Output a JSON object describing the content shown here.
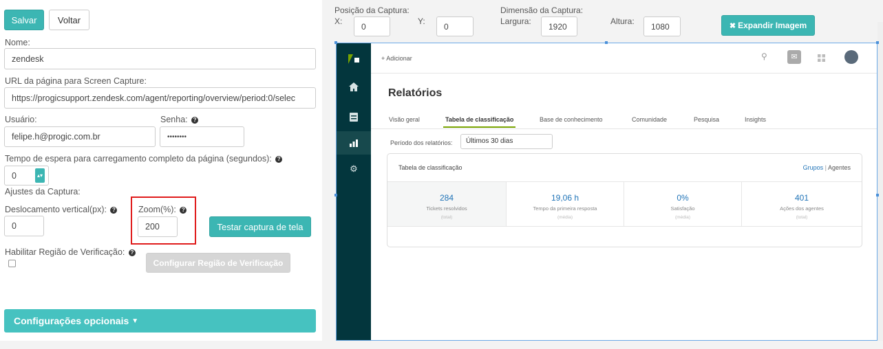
{
  "form": {
    "save_label": "Salvar",
    "back_label": "Voltar",
    "name_label": "Nome:",
    "name_value": "zendesk",
    "url_label": "URL da página para Screen Capture:",
    "url_value": "https://progicsupport.zendesk.com/agent/reporting/overview/period:0/selec",
    "user_label": "Usuário:",
    "user_value": "felipe.h@progic.com.br",
    "password_label": "Senha:",
    "password_value": "••••••••",
    "wait_label": "Tempo de espera para carregamento completo da página (segundos):",
    "wait_value": "0",
    "capture_settings_label": "Ajustes da Captura:",
    "vertical_offset_label": "Deslocamento vertical(px):",
    "vertical_offset_value": "0",
    "zoom_label": "Zoom(%):",
    "zoom_value": "200",
    "test_capture_label": "Testar captura de tela",
    "enable_region_label": "Habilitar Região de Verificação:",
    "configure_region_label": "Configurar Região de Verificação",
    "optional_settings_label": "Configurações opcionais",
    "help_glyph": "?"
  },
  "capture": {
    "position_label": "Posição da Captura:",
    "x_label": "X:",
    "x_value": "0",
    "y_label": "Y:",
    "y_value": "0",
    "dimension_label": "Dimensão da Captura:",
    "width_label": "Largura:",
    "width_value": "1920",
    "height_label": "Altura:",
    "height_value": "1080",
    "expand_label": "Expandir Imagem"
  },
  "preview": {
    "add_label": "+ Adicionar",
    "title": "Relatórios",
    "tabs": [
      "Visão geral",
      "Tabela de classificação",
      "Base de conhecimento",
      "Comunidade",
      "Pesquisa",
      "Insights"
    ],
    "period_label": "Período dos relatórios:",
    "period_value": "Últimos 30 dias",
    "card_title": "Tabela de classificação",
    "groups_link": "Grupos",
    "agents_link": "Agentes",
    "separator": "|",
    "metrics": [
      {
        "value": "284",
        "desc": "Tickets resolvidos",
        "sub": "(total)"
      },
      {
        "value": "19,06 h",
        "desc": "Tempo da primeira resposta",
        "sub": "(média)"
      },
      {
        "value": "0%",
        "desc": "Satisfação",
        "sub": "(média)"
      },
      {
        "value": "401",
        "desc": "Ações dos agentes",
        "sub": "(total)"
      }
    ]
  },
  "colors": {
    "accent": "#3cb6b3",
    "highlight": "#e01b1b",
    "zendesk_sidebar": "#03363d",
    "link": "#1f73b7"
  }
}
